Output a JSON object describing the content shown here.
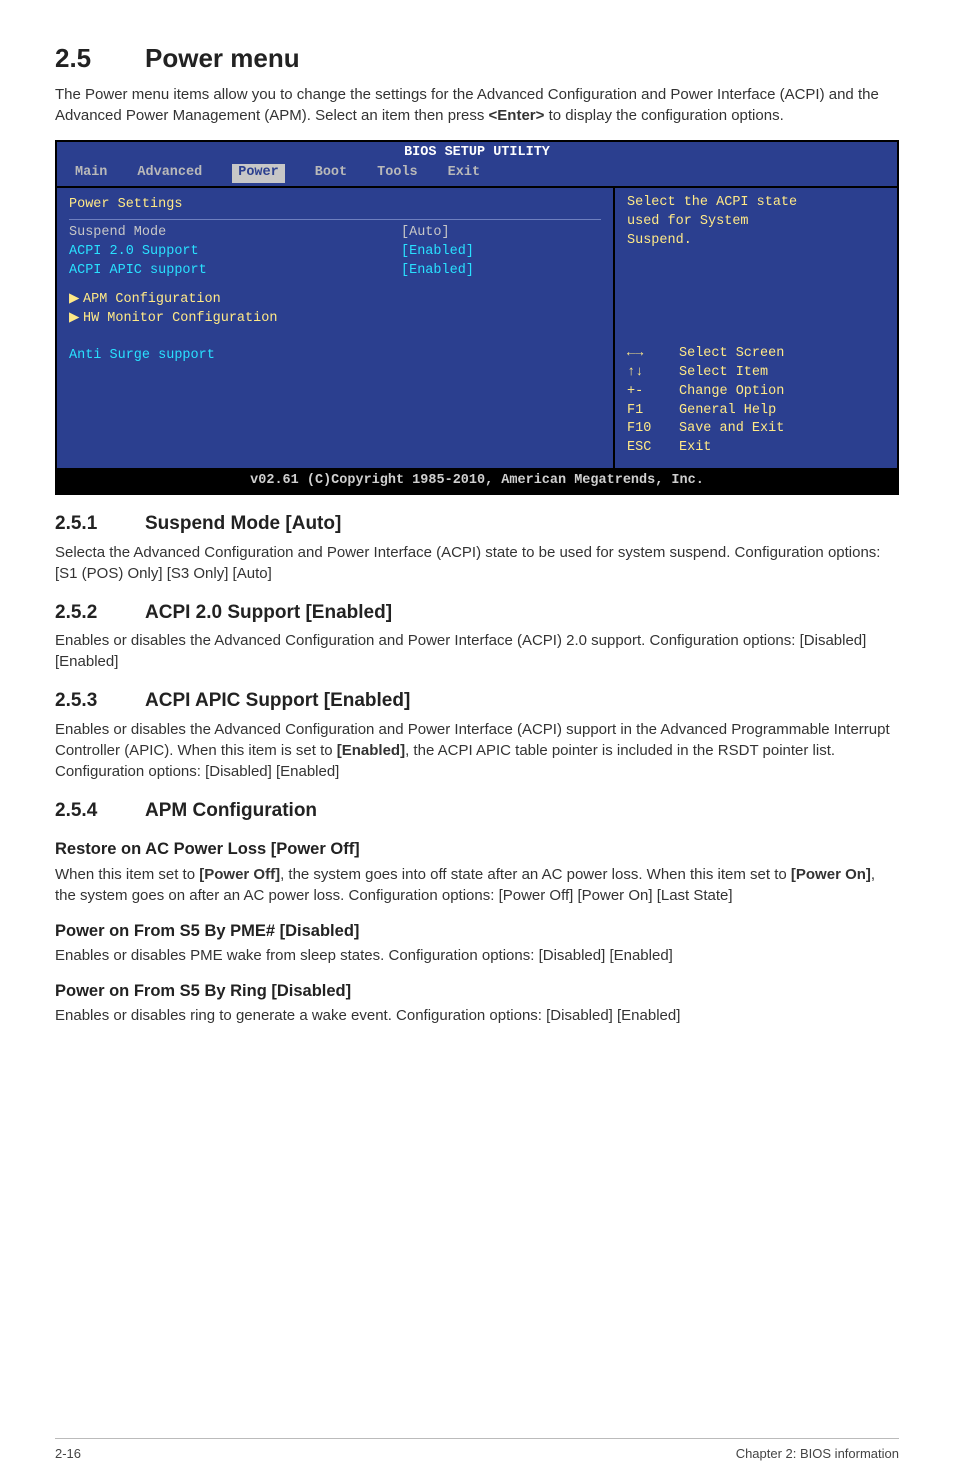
{
  "section": {
    "num": "2.5",
    "title": "Power menu"
  },
  "intro": "The Power menu items allow you to change the settings for the Advanced Configuration and Power Interface (ACPI) and the Advanced Power Management (APM). Select an item then press <Enter> to display the configuration options.",
  "intro_prefix": "The Power menu items allow you to change the settings for the Advanced Configuration and Power Interface (ACPI) and the Advanced Power Management (APM). Select an item then press ",
  "intro_bold": "<Enter>",
  "intro_suffix": " to display the configuration options.",
  "bios": {
    "title": "BIOS SETUP UTILITY",
    "tabs": [
      "Main",
      "Advanced",
      "Power",
      "Boot",
      "Tools",
      "Exit"
    ],
    "active_tab": "Power",
    "pane_heading": "Power Settings",
    "items": [
      {
        "label": "Suspend Mode",
        "value": "[Auto]",
        "selected": true
      },
      {
        "label": "ACPI 2.0 Support",
        "value": "[Enabled]",
        "selected": false
      },
      {
        "label": "ACPI APIC support",
        "value": "[Enabled]",
        "selected": false
      }
    ],
    "submenus": [
      "APM Configuration",
      "HW Monitor Configuration"
    ],
    "extra_item": "Anti Surge support",
    "help": [
      "Select the ACPI state",
      "used for System",
      "Suspend."
    ],
    "keys": [
      {
        "key": "←→",
        "desc": "Select Screen"
      },
      {
        "key": "↑↓",
        "desc": "Select Item"
      },
      {
        "key": "+-",
        "desc": "Change Option"
      },
      {
        "key": "F1",
        "desc": "General Help"
      },
      {
        "key": "F10",
        "desc": "Save and Exit"
      },
      {
        "key": "ESC",
        "desc": "Exit"
      }
    ],
    "footer": "v02.61 (C)Copyright 1985-2010, American Megatrends, Inc."
  },
  "s251": {
    "num": "2.5.1",
    "title": "Suspend Mode [Auto]",
    "body": "Selecta the Advanced Configuration and Power Interface (ACPI) state to be used for system suspend. Configuration options: [S1 (POS) Only] [S3 Only] [Auto]"
  },
  "s252": {
    "num": "2.5.2",
    "title": "ACPI 2.0 Support [Enabled]",
    "body": "Enables or disables the Advanced Configuration and Power Interface (ACPI) 2.0 support. Configuration options: [Disabled] [Enabled]"
  },
  "s253": {
    "num": "2.5.3",
    "title": "ACPI APIC Support [Enabled]",
    "body_pre": "Enables or disables the Advanced Configuration and Power Interface (ACPI) support in the Advanced Programmable Interrupt Controller (APIC). When this item is set to ",
    "body_bold": "[Enabled]",
    "body_post": ", the ACPI APIC table pointer is included in the RSDT pointer list. Configuration options: [Disabled] [Enabled]"
  },
  "s254": {
    "num": "2.5.4",
    "title": "APM Configuration",
    "h1": "Restore on AC Power Loss [Power Off]",
    "p1_a": "When this item set to ",
    "p1_b1": "[Power Off]",
    "p1_c": ", the system goes into off state after an AC power loss. When this item set to ",
    "p1_b2": "[Power On]",
    "p1_d": ", the system goes on after an AC power loss. Configuration options: [Power Off] [Power On] [Last State]",
    "h2": "Power on From S5 By PME# [Disabled]",
    "p2": "Enables or disables PME wake from sleep states. Configuration options: [Disabled] [Enabled]",
    "h3": "Power on From S5 By Ring [Disabled]",
    "p3": "Enables or disables ring to generate a wake event. Configuration options: [Disabled] [Enabled]"
  },
  "footer": {
    "left": "2-16",
    "right": "Chapter 2: BIOS information"
  }
}
